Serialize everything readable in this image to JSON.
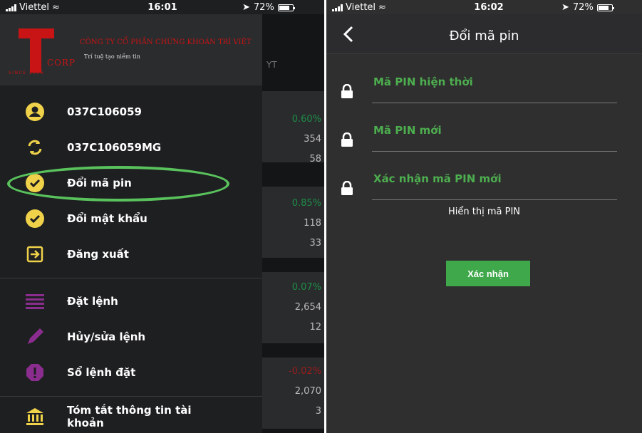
{
  "left_screen": {
    "status": {
      "carrier": "Viettel",
      "time": "16:01",
      "battery": "72%"
    },
    "header": {
      "company_name": "CÔNG TY CỔ PHẦN CHỨNG KHOÁN TRÍ VIỆT",
      "slogan": "Trí tuệ tạo niềm tin",
      "logo_corp": "CORP",
      "logo_since": "SINCE 2006"
    },
    "menu": [
      {
        "label": "037C106059",
        "icon": "user-icon"
      },
      {
        "label": "037C106059MG",
        "icon": "switch-account-icon"
      },
      {
        "label": "Đổi mã pin",
        "icon": "check-circle-icon"
      },
      {
        "label": "Đổi mật khẩu",
        "icon": "check-circle-icon"
      },
      {
        "label": "Đăng xuất",
        "icon": "logout-icon"
      },
      {
        "label": "Đặt lệnh",
        "icon": "order-list-icon"
      },
      {
        "label": "Hủy/sửa lệnh",
        "icon": "pencil-icon"
      },
      {
        "label": "Sổ lệnh đặt",
        "icon": "alert-icon"
      },
      {
        "label": "Tóm tắt thông tin tài khoản",
        "icon": "bank-icon"
      }
    ],
    "background_list": {
      "header": "YT",
      "values": [
        "0.60%",
        "354",
        "58",
        "0.85%",
        "118",
        "33",
        "0.07%",
        "2,654",
        "12",
        "-0.02%",
        "2,070",
        "3"
      ]
    }
  },
  "right_screen": {
    "status": {
      "carrier": "Viettel",
      "time": "16:02",
      "battery": "72%"
    },
    "title": "Đổi mã pin",
    "fields": [
      {
        "label": "Mã PIN hiện thời"
      },
      {
        "label": "Mã PIN mới"
      },
      {
        "label": "Xác nhận mã PIN mới"
      }
    ],
    "show_pin": "Hiển thị mã PIN",
    "confirm": "Xác nhận"
  },
  "colors": {
    "accent_green": "#4dae4f",
    "highlight": "#59c25c",
    "brand_red": "#c81414",
    "icon_yellow": "#f0d24a",
    "icon_purple": "#8b2d8f"
  }
}
